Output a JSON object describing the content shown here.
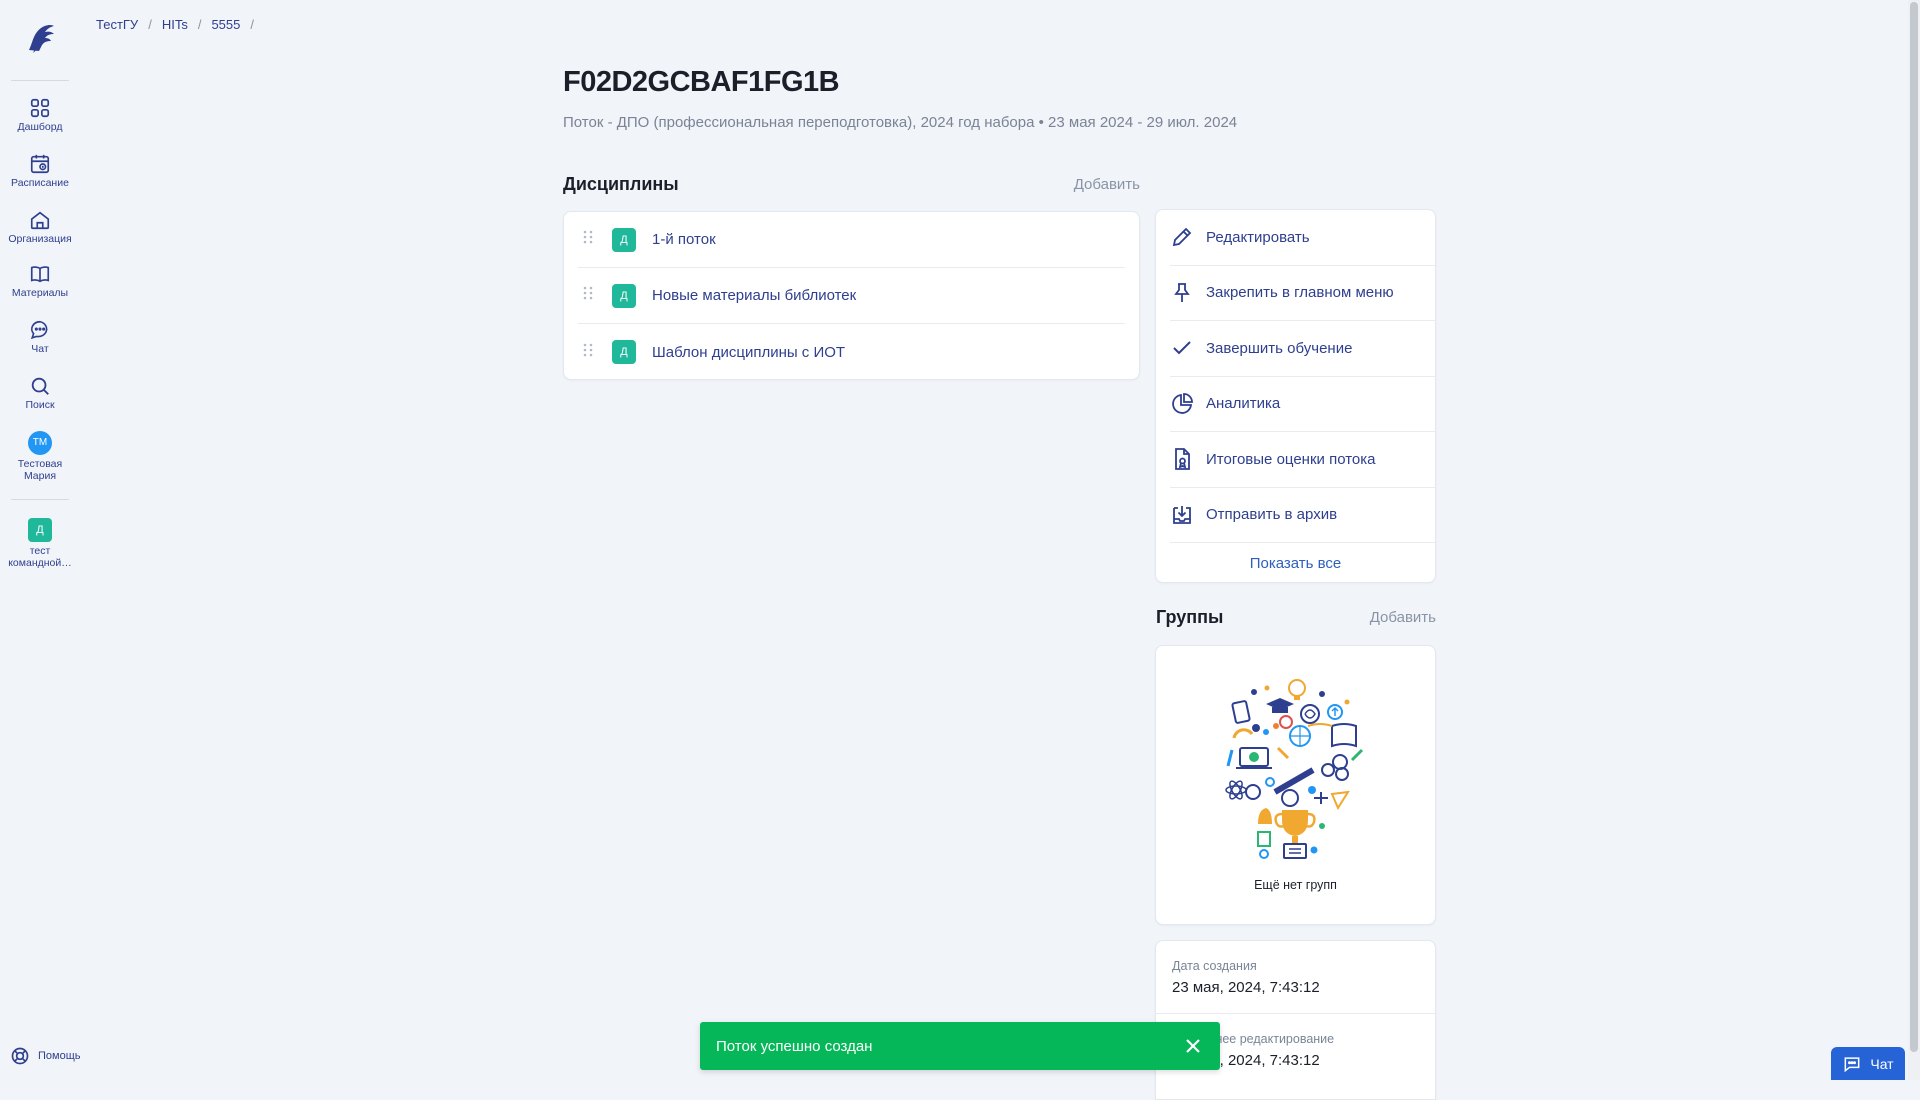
{
  "sidebar": {
    "items": [
      {
        "label": "Дашборд",
        "icon": "dashboard-icon"
      },
      {
        "label": "Расписание",
        "icon": "calendar-icon"
      },
      {
        "label": "Организация",
        "icon": "home-icon"
      },
      {
        "label": "Материалы",
        "icon": "book-icon"
      },
      {
        "label": "Чат",
        "icon": "chat-icon"
      },
      {
        "label": "Поиск",
        "icon": "search-icon"
      }
    ],
    "user": {
      "initials": "ТМ",
      "name": "Тестовая Мария"
    },
    "pinned": {
      "badge": "Д",
      "label": "тест командной…"
    },
    "help_label": "Помощь"
  },
  "breadcrumb": [
    "ТестГУ",
    "HITs",
    "5555"
  ],
  "header": {
    "title": "F02D2GCBAF1FG1B",
    "subtitle": "Поток - ДПО (профессиональная переподготовка), 2024 год набора • 23 мая 2024 - 29 июл. 2024"
  },
  "disciplines": {
    "title": "Дисциплины",
    "add_label": "Добавить",
    "items": [
      {
        "badge": "Д",
        "label": "1-й поток"
      },
      {
        "badge": "Д",
        "label": "Новые материалы библиотек"
      },
      {
        "badge": "Д",
        "label": "Шаблон дисциплины с ИОТ"
      }
    ]
  },
  "actions": {
    "items": [
      {
        "label": "Редактировать",
        "icon": "pencil-icon"
      },
      {
        "label": "Закрепить в главном меню",
        "icon": "pin-icon"
      },
      {
        "label": "Завершить обучение",
        "icon": "check-icon"
      },
      {
        "label": "Аналитика",
        "icon": "pie-chart-icon"
      },
      {
        "label": "Итоговые оценки потока",
        "icon": "grade-document-icon"
      },
      {
        "label": "Отправить в архив",
        "icon": "archive-icon"
      }
    ],
    "show_all_label": "Показать все"
  },
  "groups": {
    "title": "Группы",
    "add_label": "Добавить",
    "empty_text": "Ещё нет групп"
  },
  "info": {
    "created_label": "Дата создания",
    "created_value": "23 мая, 2024, 7:43:12",
    "edited_label": "Последнее редактирование",
    "edited_value": "23 мая, 2024, 7:43:12"
  },
  "toast": {
    "message": "Поток успешно создан"
  },
  "chat_button": {
    "label": "Чат"
  },
  "colors": {
    "accent": "#2e3f8f",
    "badge": "#1fb89a",
    "toast": "#05b758",
    "chat": "#2563d6"
  }
}
